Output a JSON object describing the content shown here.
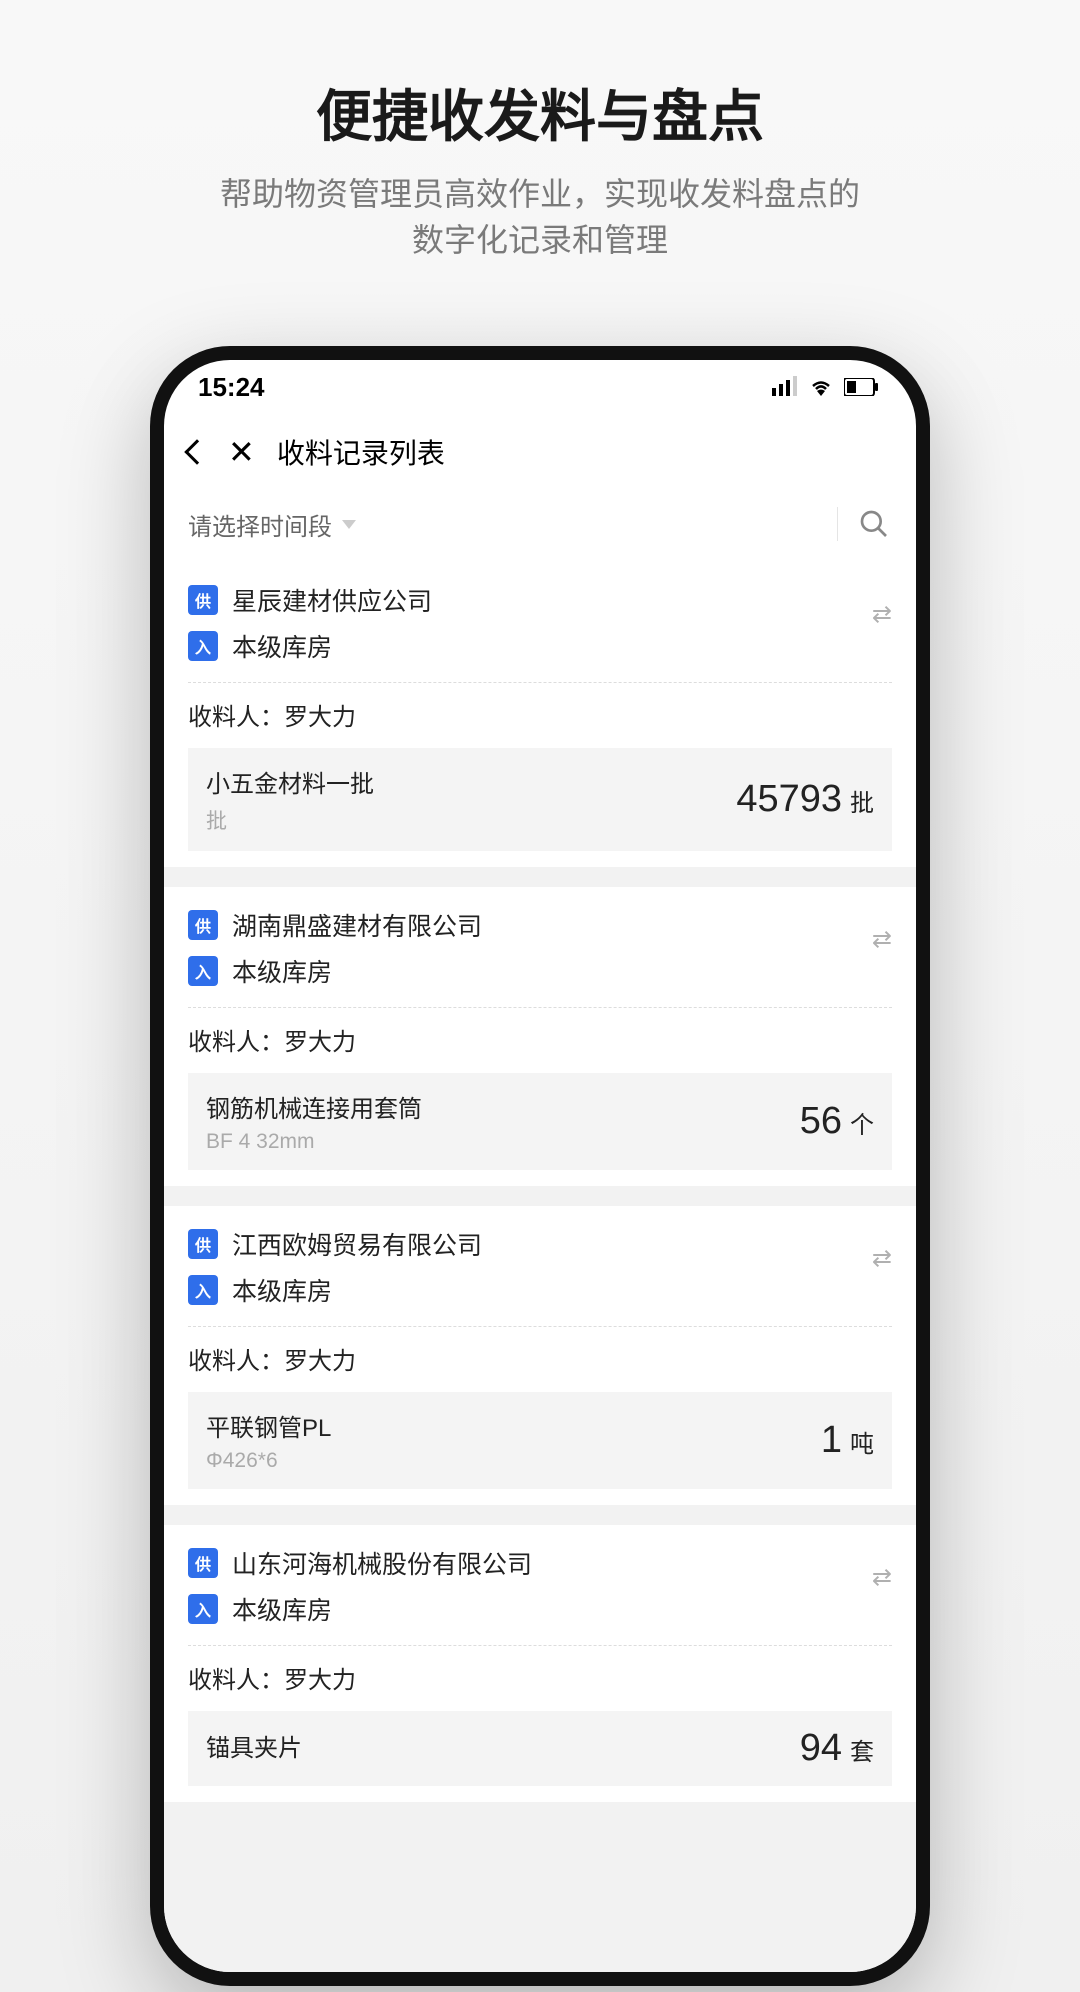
{
  "promo": {
    "title": "便捷收发料与盘点",
    "subtitle_l1": "帮助物资管理员高效作业，实现收发料盘点的",
    "subtitle_l2": "数字化记录和管理"
  },
  "status": {
    "time": "15:24"
  },
  "nav": {
    "title": "收料记录列表"
  },
  "filter": {
    "placeholder": "请选择时间段"
  },
  "receiver_prefix": "收料人：",
  "records": [
    {
      "supplier": "星辰建材供应公司",
      "warehouse": "本级库房",
      "receiver": "罗大力",
      "item_name": "小五金材料一批",
      "item_spec": "批",
      "qty": "45793",
      "unit": "批"
    },
    {
      "supplier": "湖南鼎盛建材有限公司",
      "warehouse": "本级库房",
      "receiver": "罗大力",
      "item_name": "钢筋机械连接用套筒",
      "item_spec": "BF 4 32mm",
      "qty": "56",
      "unit": "个"
    },
    {
      "supplier": "江西欧姆贸易有限公司",
      "warehouse": "本级库房",
      "receiver": "罗大力",
      "item_name": "平联钢管PL",
      "item_spec": "Φ426*6",
      "qty": "1",
      "unit": "吨"
    },
    {
      "supplier": "山东河海机械股份有限公司",
      "warehouse": "本级库房",
      "receiver": "罗大力",
      "item_name": "锚具夹片",
      "item_spec": "",
      "qty": "94",
      "unit": "套"
    }
  ]
}
